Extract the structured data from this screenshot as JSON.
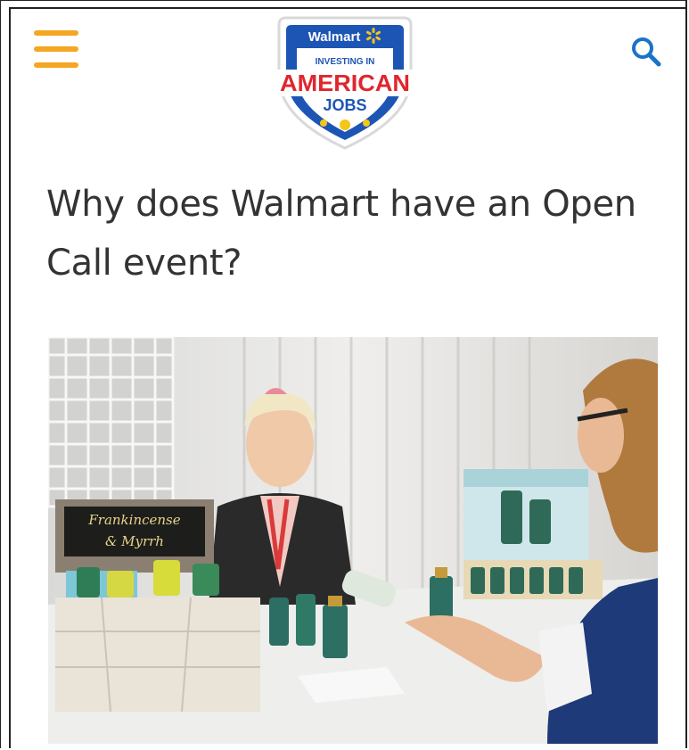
{
  "header": {
    "menu_icon": "hamburger-menu-icon",
    "search_icon": "search-icon",
    "logo": {
      "brand": "Walmart",
      "line1": "INVESTING IN",
      "line2": "AMERICAN",
      "line3": "JOBS"
    }
  },
  "article": {
    "headline": "Why does Walmart have an Open Call event?"
  },
  "photo": {
    "sign_line1": "Frankincense",
    "sign_line2": "& Myrrh"
  },
  "colors": {
    "accent": "#f5a623",
    "search": "#1a73c7",
    "logo_blue": "#1d55b5",
    "logo_red": "#e0262d"
  }
}
